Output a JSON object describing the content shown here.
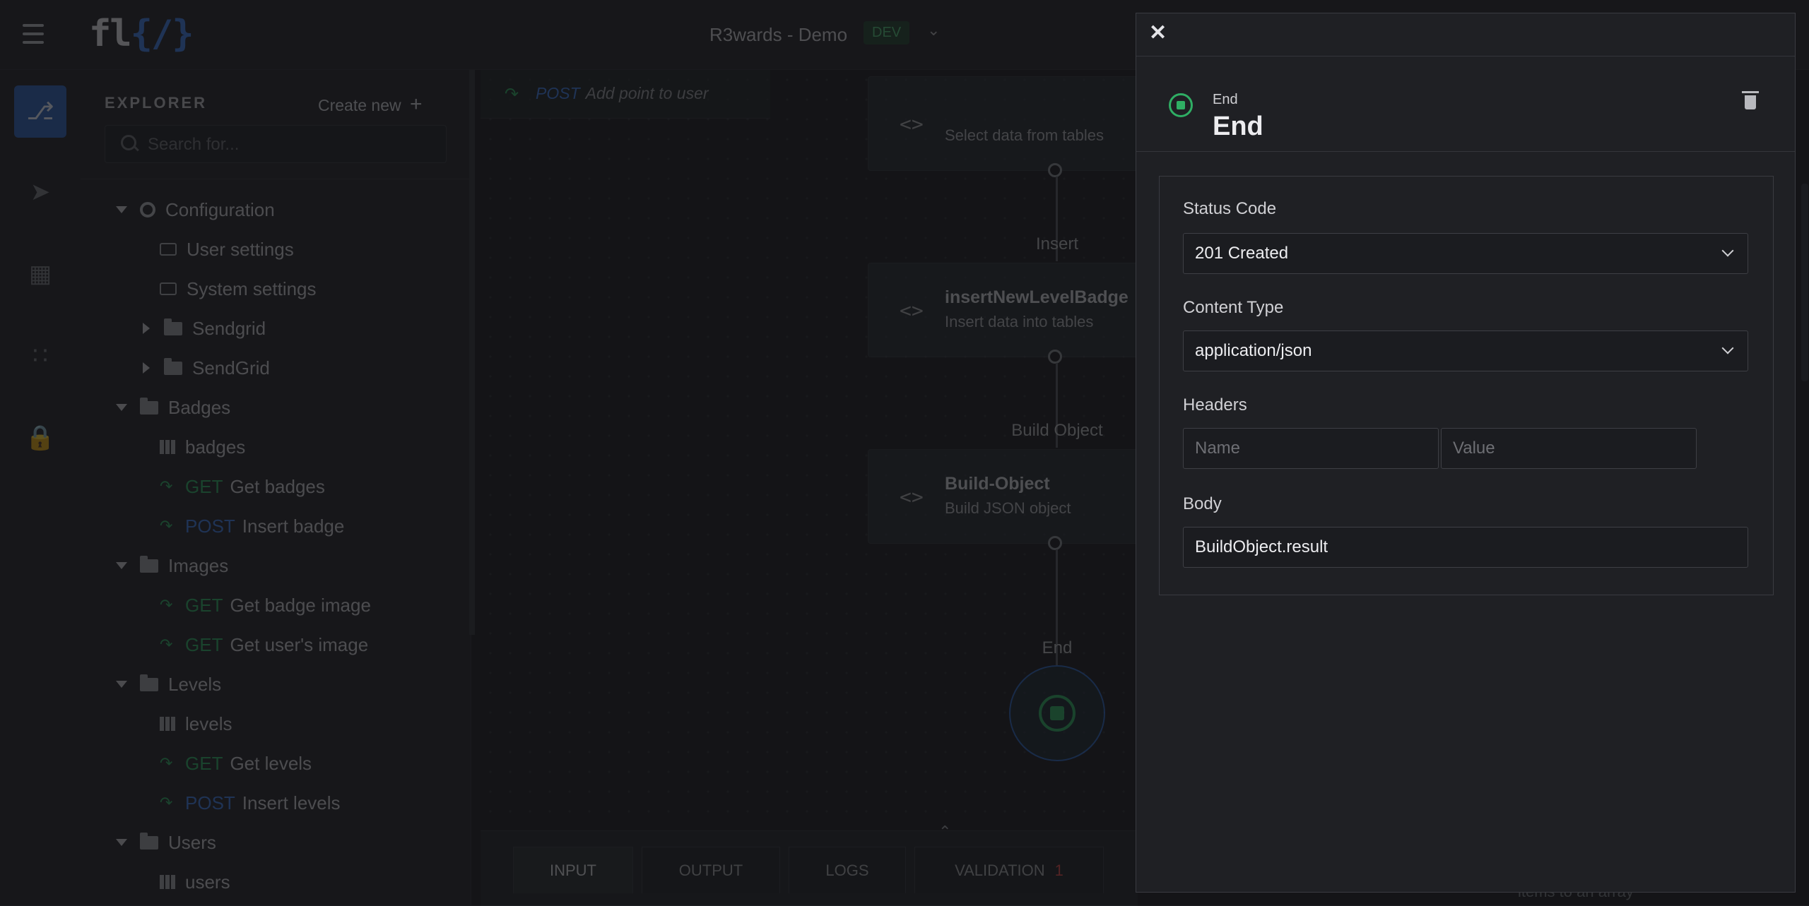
{
  "header": {
    "logo": "fl",
    "logo_brace": "{/}",
    "project": "R3wards - Demo",
    "env": "DEV"
  },
  "explorer": {
    "title": "EXPLORER",
    "create_new": "Create new",
    "search_placeholder": "Search for...",
    "tree": {
      "configuration": "Configuration",
      "user_settings": "User settings",
      "system_settings": "System settings",
      "sendgrid1": "Sendgrid",
      "sendgrid2": "SendGrid",
      "badges_folder": "Badges",
      "badges_table": "badges",
      "get_badges": {
        "method": "GET",
        "label": "Get badges"
      },
      "insert_badge": {
        "method": "POST",
        "label": "Insert badge"
      },
      "images_folder": "Images",
      "get_badge_image": {
        "method": "GET",
        "label": "Get badge image"
      },
      "get_user_image": {
        "method": "GET",
        "label": "Get user's image"
      },
      "levels_folder": "Levels",
      "levels_table": "levels",
      "get_levels": {
        "method": "GET",
        "label": "Get levels"
      },
      "insert_levels": {
        "method": "POST",
        "label": "Insert levels"
      },
      "users_folder": "Users",
      "users_table": "users"
    }
  },
  "editor": {
    "tab": {
      "method": "POST",
      "label": "Add point to user"
    },
    "nodes": {
      "select": {
        "subtitle": "Select data from tables"
      },
      "insert": {
        "edge_label": "Insert",
        "title": "insertNewLevelBadge",
        "subtitle": "Insert data into tables"
      },
      "build": {
        "edge_label": "Build Object",
        "title": "Build-Object",
        "subtitle": "Build JSON object"
      },
      "end": {
        "edge_label": "End"
      }
    },
    "code_icon": "<>",
    "bottom_tabs": [
      "INPUT",
      "OUTPUT",
      "LOGS",
      "VALIDATION"
    ],
    "validation_count": "1",
    "behind_text": "items to an array"
  },
  "drawer": {
    "node_type": "End",
    "node_name": "End",
    "status_code_label": "Status Code",
    "status_code_value": "201 Created",
    "content_type_label": "Content Type",
    "content_type_value": "application/json",
    "headers_label": "Headers",
    "header_name_placeholder": "Name",
    "header_value_placeholder": "Value",
    "body_label": "Body",
    "body_value": "BuildObject.result"
  },
  "colors": {
    "accent": "#2e63b8",
    "get": "#2fae64",
    "post": "#3f7be0",
    "error": "#e14b4b"
  }
}
